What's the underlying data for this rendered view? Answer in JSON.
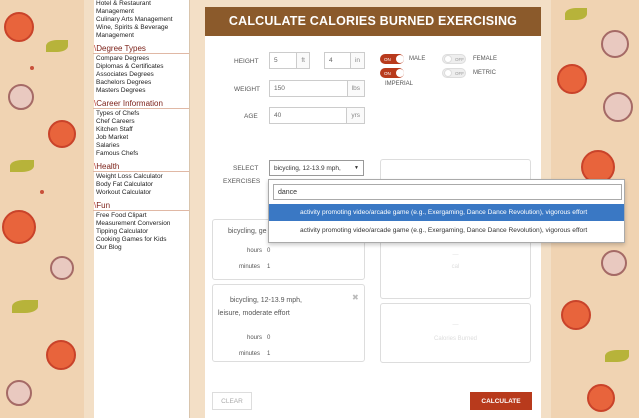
{
  "sidebar": {
    "top_links": [
      "Hotel & Restaurant",
      "Management",
      "Culinary Arts Management",
      "Wine, Spirits & Beverage",
      "Management"
    ],
    "sections": [
      {
        "title": "Degree Types",
        "links": [
          "Compare Degrees",
          "Diplomas & Certificates",
          "Associates Degrees",
          "Bachelors Degrees",
          "Masters Degrees"
        ]
      },
      {
        "title": "Career Information",
        "links": [
          "Types of Chefs",
          "Chef Careers",
          "Kitchen Staff",
          "Job Market",
          "Salaries",
          "Famous Chefs"
        ]
      },
      {
        "title": "Health",
        "links": [
          "Weight Loss Calculator",
          "Body Fat Calculator",
          "Workout Calculator"
        ]
      },
      {
        "title": "Fun",
        "links": [
          "Free Food Clipart",
          "Measurement Conversion",
          "Tipping Calculator",
          "Cooking Games for Kids",
          "Our Blog"
        ]
      }
    ]
  },
  "header": {
    "title": "CALCULATE CALORIES BURNED EXERCISING"
  },
  "form": {
    "height_label": "HEIGHT",
    "height_ft_value": "5",
    "height_ft_unit": "ft",
    "height_in_value": "4",
    "height_in_unit": "in",
    "weight_label": "WEIGHT",
    "weight_value": "150",
    "weight_unit": "lbs",
    "age_label": "AGE",
    "age_value": "40",
    "age_unit": "yrs",
    "toggle_on_text": "ON",
    "toggle_off_text": "OFF",
    "male_label": "MALE",
    "female_label": "FEMALE",
    "imperial_label": "IMPERIAL",
    "metric_label": "METRIC",
    "select_label_1": "SELECT",
    "select_label_2": "EXERCISES",
    "select_value": "bicycling, 12-13.9 mph,"
  },
  "exercise_panels": [
    {
      "text_1": "bicycling, ge",
      "hours_label": "hours",
      "hours_value": "0",
      "minutes_label": "minutes",
      "minutes_value": "1"
    },
    {
      "text_1": "bicycling, 12-13.9 mph,",
      "text_2": "leisure, moderate effort",
      "close": "✖",
      "hours_label": "hours",
      "hours_value": "0",
      "minutes_label": "minutes",
      "minutes_value": "1"
    }
  ],
  "results": {
    "ghost_1": "—",
    "ghost_1b": "cal",
    "ghost_2": "—",
    "ghost_2b": "Calories Burned"
  },
  "buttons": {
    "clear": "CLEAR",
    "calculate": "CALCULATE"
  },
  "dropdown": {
    "search_value": "dance",
    "options": [
      "activity promoting video/arcade game (e.g., Exergaming, Dance Dance Revolution), vigorous effort",
      "activity promoting video/arcade game (e.g., Exergaming, Dance Dance Revolution), vigorous effort"
    ],
    "highlighted_index": 0
  },
  "colors": {
    "accent": "#b83a1c",
    "header": "#8b5a2b",
    "highlight": "#3a78c4",
    "section_heading": "#7a1e16"
  }
}
